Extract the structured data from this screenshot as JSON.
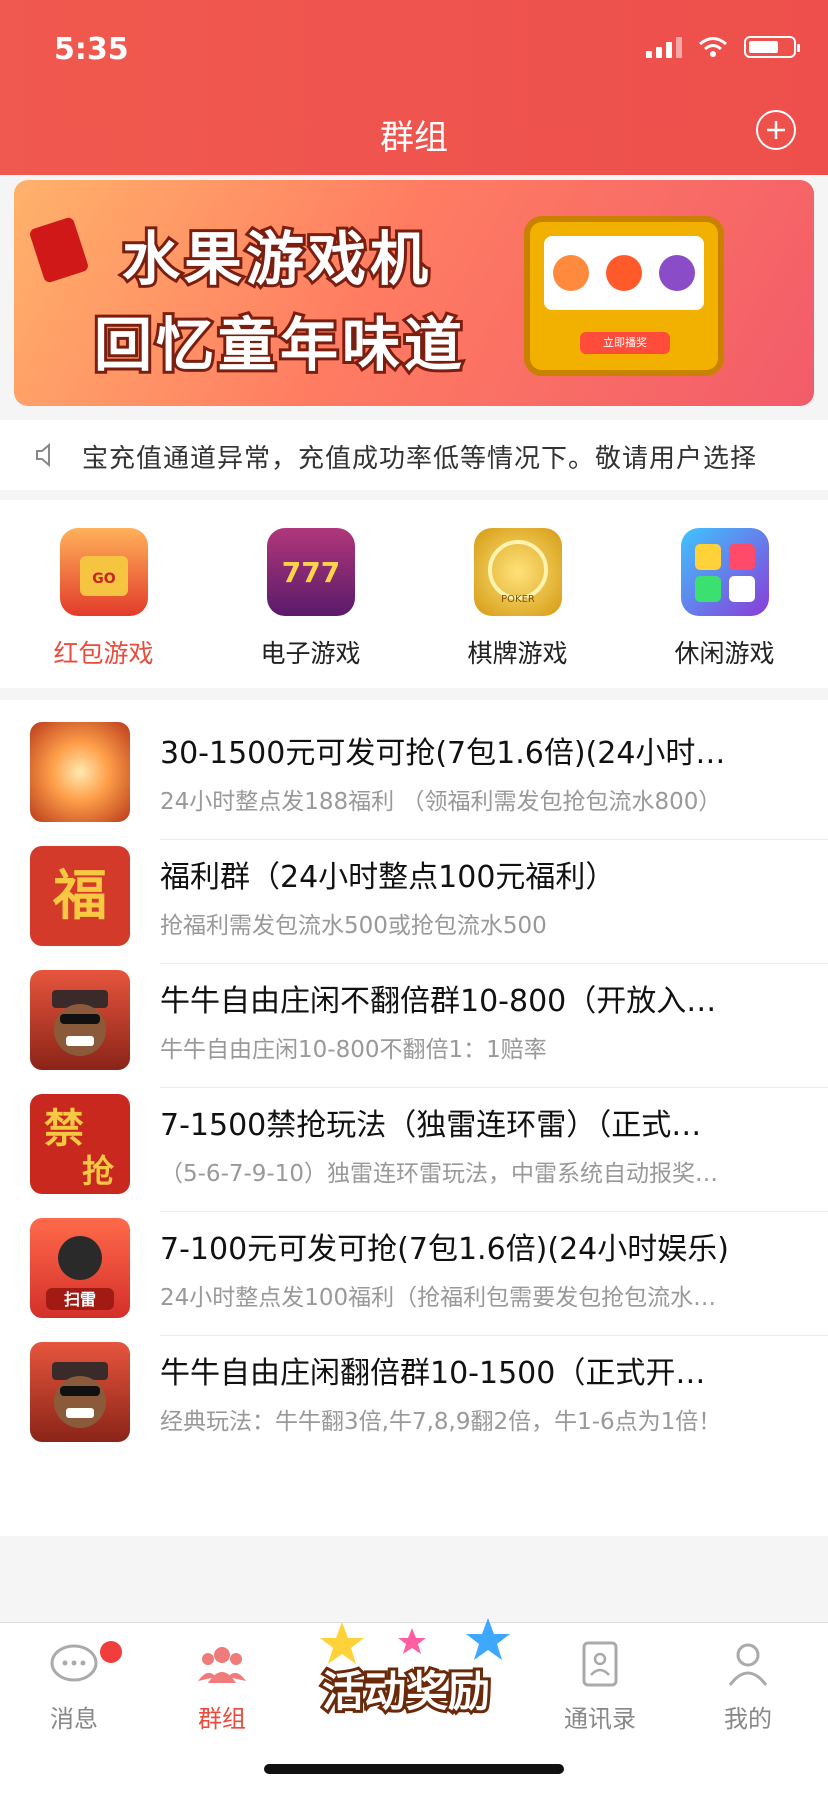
{
  "status": {
    "time": "5:35"
  },
  "header": {
    "title": "群组"
  },
  "banner": {
    "line1": "水果游戏机",
    "line2": "回忆童年味道",
    "button": "立即播奖"
  },
  "notice": {
    "text": "宝充值通道异常，充值成功率低等情况下。敬请用户选择"
  },
  "categories": [
    {
      "label": "红包游戏",
      "icon": "red-envelope-icon"
    },
    {
      "label": "电子游戏",
      "icon": "slot-777-icon"
    },
    {
      "label": "棋牌游戏",
      "icon": "poker-chip-icon"
    },
    {
      "label": "休闲游戏",
      "icon": "gems-icon"
    }
  ],
  "groups": [
    {
      "title": "30-1500元可发可抢(7包1.6倍)(24小时…",
      "sub": "24小时整点发188福利 （领福利需发包抢包流水800）",
      "icon": "explosion-icon"
    },
    {
      "title": "福利群（24小时整点100元福利）",
      "sub": "抢福利需发包流水500或抢包流水500",
      "icon": "fu-character-icon"
    },
    {
      "title": "牛牛自由庄闲不翻倍群10-800（开放入…",
      "sub": "牛牛自由庄闲10-800不翻倍1：1赔率",
      "icon": "bull-mascot-icon"
    },
    {
      "title": "7-1500禁抢玩法（独雷连环雷）（正式…",
      "sub": "（5-6-7-9-10）独雷连环雷玩法，中雷系统自动报奖…",
      "icon": "jin-qiang-icon"
    },
    {
      "title": "7-100元可发可抢(7包1.6倍)(24小时娱乐)",
      "sub": "24小时整点发100福利（抢福利包需要发包抢包流水…",
      "icon": "bomb-icon"
    },
    {
      "title": "牛牛自由庄闲翻倍群10-1500（正式开…",
      "sub": "经典玩法：牛牛翻3倍,牛7,8,9翻2倍，牛1-6点为1倍！",
      "icon": "bull-mascot-icon"
    }
  ],
  "group_icon_labels": {
    "jin": "禁",
    "qiang": "抢",
    "fu": "福",
    "bomb": "扫雷"
  },
  "tabs": [
    {
      "label": "消息",
      "icon": "chat-icon"
    },
    {
      "label": "群组",
      "icon": "group-icon"
    },
    {
      "label": "通讯录",
      "icon": "contacts-icon"
    },
    {
      "label": "我的",
      "icon": "person-icon"
    }
  ],
  "promo": {
    "text": "活动奖励"
  },
  "colors": {
    "accent": "#e94b3c",
    "header": "#f0594f"
  }
}
